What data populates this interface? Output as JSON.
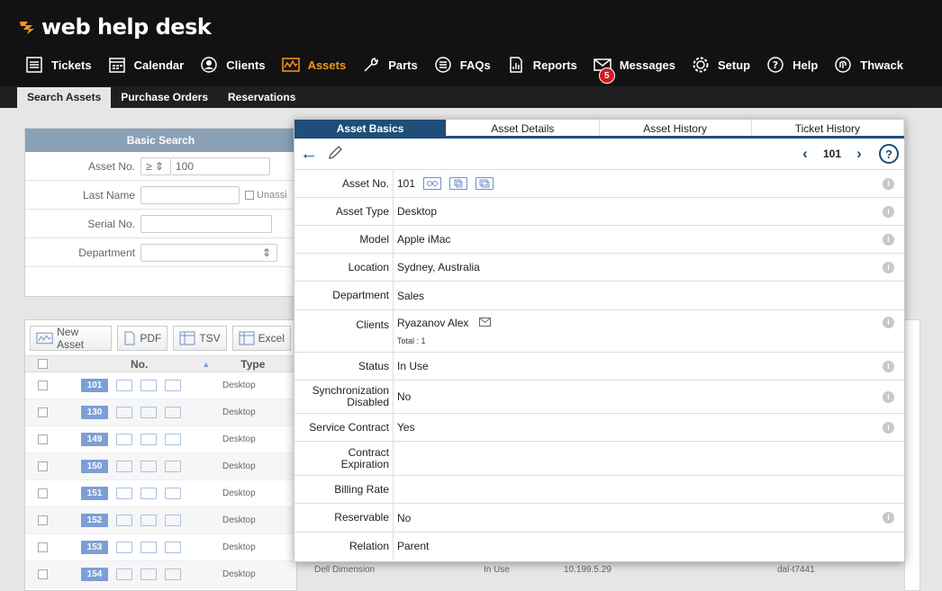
{
  "app": {
    "logo_text": "web help desk"
  },
  "nav": [
    {
      "label": "Tickets",
      "icon": "tickets-icon"
    },
    {
      "label": "Calendar",
      "icon": "calendar-icon"
    },
    {
      "label": "Clients",
      "icon": "clients-icon"
    },
    {
      "label": "Assets",
      "icon": "assets-icon",
      "active": true
    },
    {
      "label": "Parts",
      "icon": "parts-icon"
    },
    {
      "label": "FAQs",
      "icon": "faqs-icon"
    },
    {
      "label": "Reports",
      "icon": "reports-icon"
    },
    {
      "label": "Messages",
      "icon": "messages-icon",
      "badge": "5"
    },
    {
      "label": "Setup",
      "icon": "setup-icon"
    },
    {
      "label": "Help",
      "icon": "help-icon"
    },
    {
      "label": "Thwack",
      "icon": "thwack-icon"
    }
  ],
  "subnav": [
    "Search Assets",
    "Purchase Orders",
    "Reservations"
  ],
  "basic_search": {
    "title": "Basic Search",
    "asset_no_label": "Asset No.",
    "asset_no_op": "≥ ⇕",
    "asset_no_value": "100",
    "last_name_label": "Last Name",
    "unassigned_label": "Unassi",
    "serial_label": "Serial No.",
    "department_label": "Department"
  },
  "toolbar": {
    "new_asset": "New Asset",
    "pdf": "PDF",
    "tsv": "TSV",
    "excel": "Excel"
  },
  "list": {
    "col_no": "No.",
    "col_type": "Type",
    "rows": [
      {
        "no": "101",
        "type": "Desktop"
      },
      {
        "no": "130",
        "type": "Desktop"
      },
      {
        "no": "149",
        "type": "Desktop"
      },
      {
        "no": "150",
        "type": "Desktop"
      },
      {
        "no": "151",
        "type": "Desktop"
      },
      {
        "no": "152",
        "type": "Desktop"
      },
      {
        "no": "153",
        "type": "Desktop"
      },
      {
        "no": "154",
        "type": "Desktop"
      }
    ],
    "behind_last_row": {
      "model": "Dell Dimension",
      "status": "In Use",
      "ip": "10.199.5.29",
      "name": "dal-t7441"
    }
  },
  "popup": {
    "tabs": [
      "Asset Basics",
      "Asset Details",
      "Asset History",
      "Ticket History"
    ],
    "page_num": "101",
    "help": "?",
    "fields": {
      "asset_no": {
        "label": "Asset No.",
        "value": "101"
      },
      "asset_type": {
        "label": "Asset Type",
        "value": "Desktop"
      },
      "model": {
        "label": "Model",
        "value": "Apple iMac"
      },
      "location": {
        "label": "Location",
        "value": "Sydney, Australia"
      },
      "department": {
        "label": "Department",
        "value": "Sales"
      },
      "clients": {
        "label": "Clients",
        "value": "Ryazanov Alex",
        "total": "Total : 1"
      },
      "status": {
        "label": "Status",
        "value": "In Use"
      },
      "sync_disabled": {
        "label_1": "Synchronization",
        "label_2": "Disabled",
        "value": "No"
      },
      "service_contract": {
        "label": "Service Contract",
        "value": "Yes"
      },
      "contract_expiration": {
        "label_1": "Contract",
        "label_2": "Expiration",
        "value": ""
      },
      "billing_rate": {
        "label": "Billing Rate",
        "value": ""
      },
      "reservable": {
        "label": "Reservable",
        "value": "No"
      },
      "relation": {
        "label": "Relation",
        "value": "Parent"
      }
    }
  },
  "colors": {
    "accent_orange": "#f7941d",
    "dark_blue": "#1f4e79",
    "badge_blue": "#7b9fd5",
    "badge_red": "#d71920"
  }
}
